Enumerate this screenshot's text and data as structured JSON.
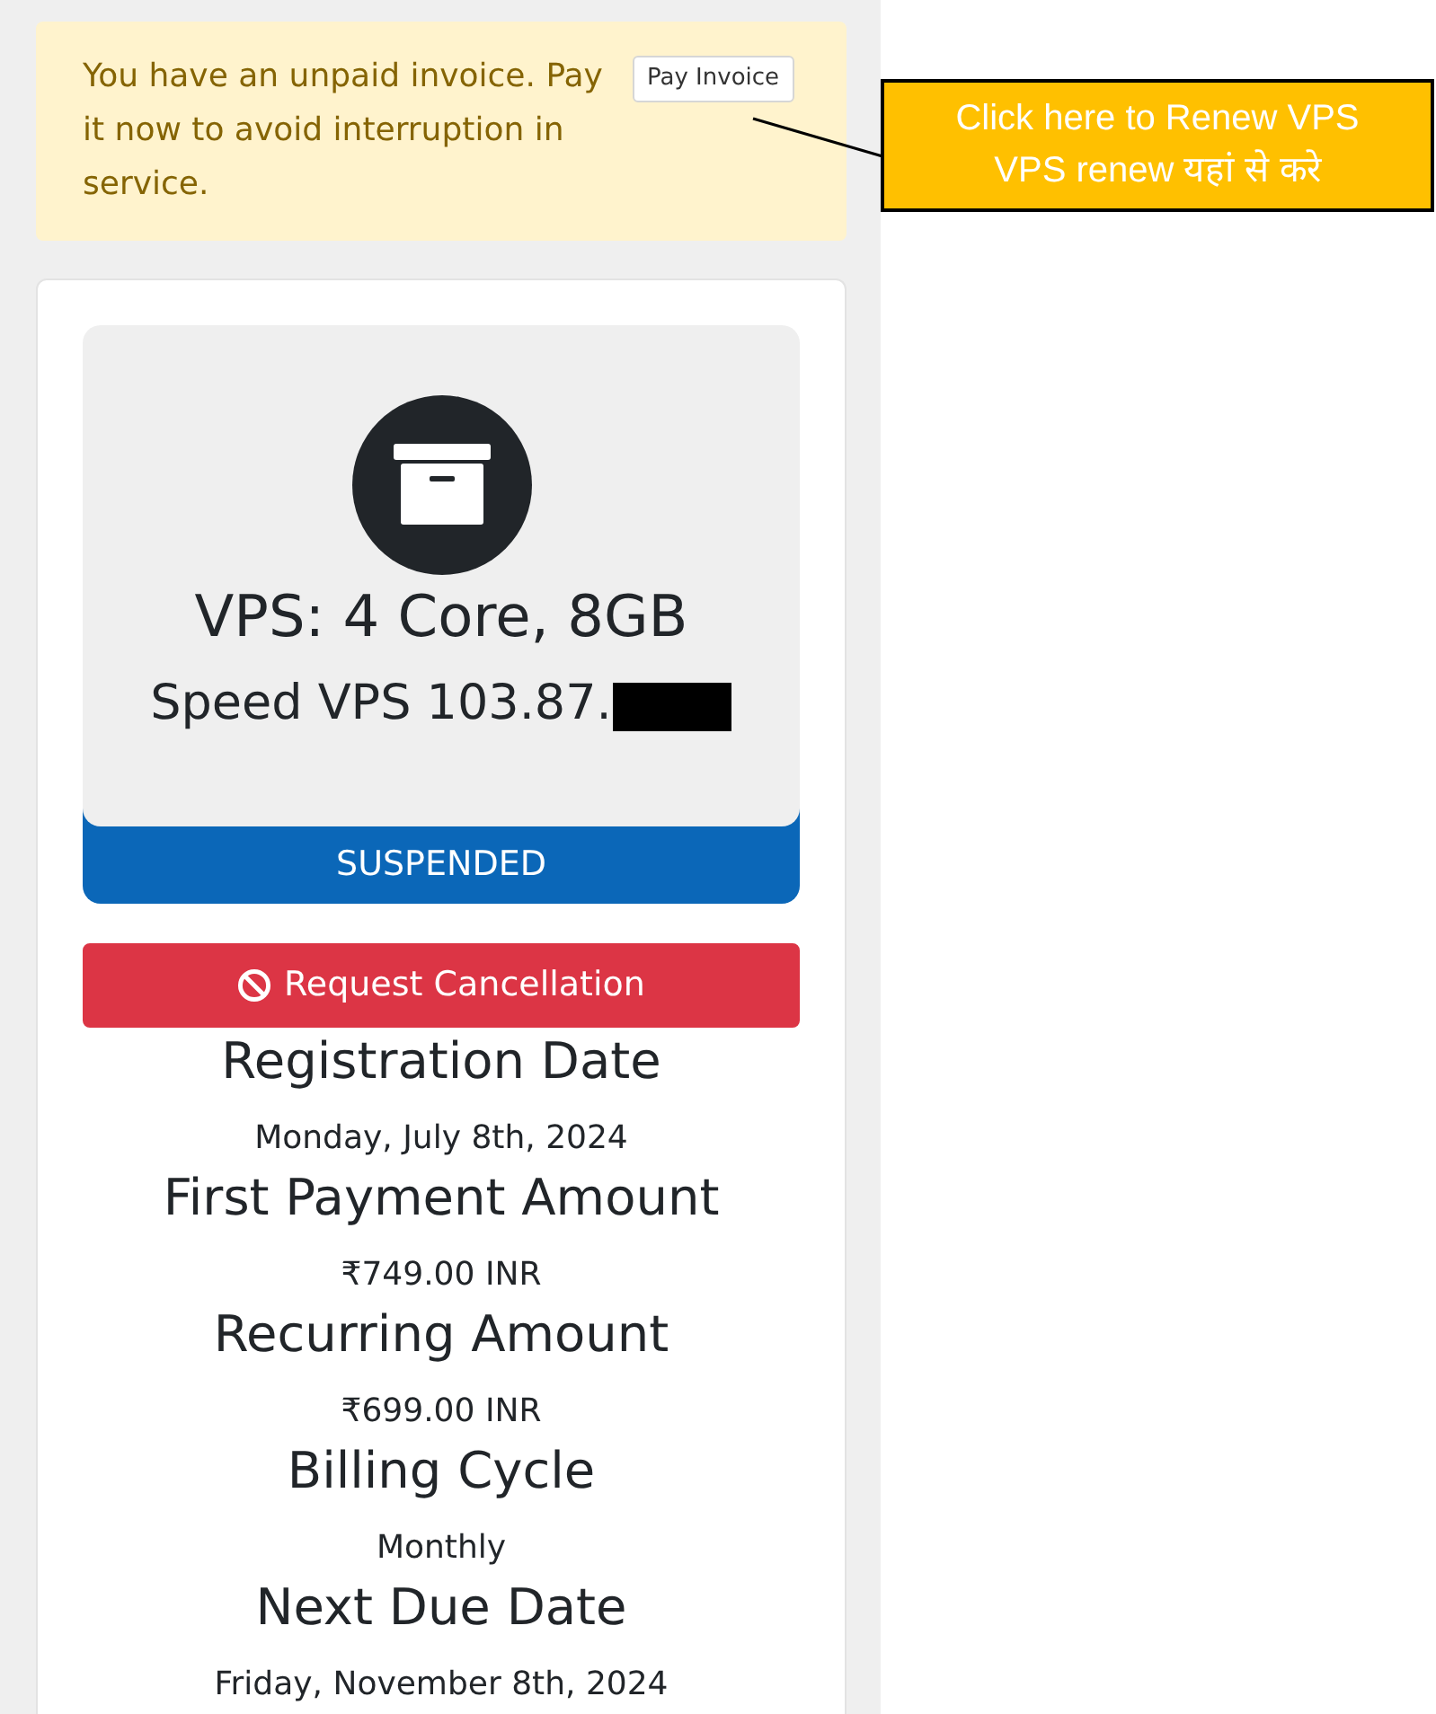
{
  "alert": {
    "message": "You have an unpaid invoice. Pay it now to avoid interruption in service.",
    "button": "Pay Invoice"
  },
  "annotation": {
    "lines": [
      "Click here to Renew VPS",
      "VPS renew यहां से करे"
    ]
  },
  "product": {
    "title": "VPS: 4 Core, 8GB",
    "subtitle": "Speed VPS 103.87.",
    "redacted": true,
    "status": "SUSPENDED"
  },
  "cancel_button": {
    "label": "Request Cancellation"
  },
  "details": [
    {
      "label": "Registration Date",
      "value": "Monday, July 8th, 2024"
    },
    {
      "label": "First Payment Amount",
      "value": "₹749.00 INR"
    },
    {
      "label": "Recurring Amount",
      "value": "₹699.00 INR"
    },
    {
      "label": "Billing Cycle",
      "value": "Monthly"
    },
    {
      "label": "Next Due Date",
      "value": "Friday, November 8th, 2024"
    }
  ]
}
